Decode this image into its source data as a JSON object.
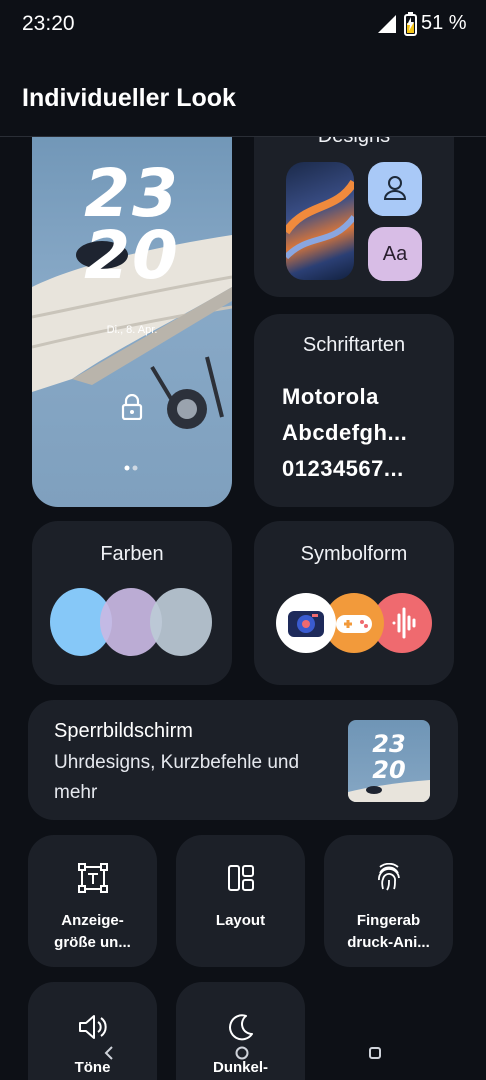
{
  "status": {
    "time": "23:20",
    "battery": "51 %"
  },
  "header": {
    "title": "Individueller Look"
  },
  "lockscreen_preview": {
    "hour": "23",
    "minute": "20",
    "date": "Di., 8. Apr."
  },
  "designs": {
    "title": "Designs",
    "font_badge": "Aa"
  },
  "fonts": {
    "title": "Schriftarten",
    "line1": "Motorola",
    "line2": "Abcdefgh...",
    "line3": "01234567..."
  },
  "colors": {
    "title": "Farben",
    "swatches": [
      "#86c8f8",
      "#c9b9e3",
      "#bccad6"
    ]
  },
  "icon_shape": {
    "title": "Symbolform"
  },
  "lockscreen": {
    "title": "Sperrbildschirm",
    "description": "Uhrdesigns, Kurzbefehle und mehr",
    "thumb_hour": "23",
    "thumb_minute": "20"
  },
  "tiles": [
    {
      "label": "Anzeige-\ngröße un..."
    },
    {
      "label": "Layout"
    },
    {
      "label": "Fingerab\ndruck-Ani..."
    },
    {
      "label": "Töne"
    },
    {
      "label": "Dunkel-"
    }
  ],
  "icons": {
    "signal": "signal-icon",
    "battery": "battery-icon",
    "lock": "lock-icon",
    "user": "user-icon",
    "camera": "camera-icon",
    "gamepad": "gamepad-icon",
    "soundwave": "soundwave-icon",
    "display_size": "display-size-icon",
    "layout": "layout-icon",
    "fingerprint": "fingerprint-icon",
    "volume": "volume-icon",
    "moon": "moon-icon",
    "back": "back-icon",
    "home": "home-icon",
    "recents": "recents-icon"
  }
}
